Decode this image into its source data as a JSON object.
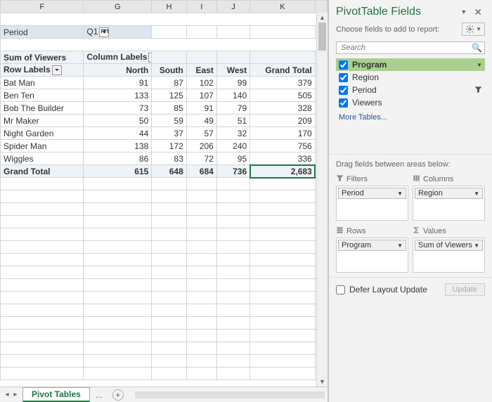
{
  "columns_visible": [
    "F",
    "G",
    "H",
    "I",
    "J",
    "K"
  ],
  "filter": {
    "label": "Period",
    "value": "Q1"
  },
  "pivot": {
    "values_label": "Sum of Viewers",
    "cols_label": "Column Labels",
    "rows_label": "Row Labels",
    "col_headers": [
      "North",
      "South",
      "East",
      "West",
      "Grand Total"
    ],
    "rows": [
      {
        "label": "Bat Man",
        "vals": [
          91,
          87,
          102,
          99,
          379
        ]
      },
      {
        "label": "Ben Ten",
        "vals": [
          133,
          125,
          107,
          140,
          505
        ]
      },
      {
        "label": "Bob The Builder",
        "vals": [
          73,
          85,
          91,
          79,
          328
        ]
      },
      {
        "label": "Mr Maker",
        "vals": [
          50,
          59,
          49,
          51,
          209
        ]
      },
      {
        "label": "Night Garden",
        "vals": [
          44,
          37,
          57,
          32,
          170
        ]
      },
      {
        "label": "Spider Man",
        "vals": [
          138,
          172,
          206,
          240,
          756
        ]
      },
      {
        "label": "Wiggles",
        "vals": [
          86,
          83,
          72,
          95,
          336
        ]
      }
    ],
    "grand_total_label": "Grand Total",
    "grand_total": [
      615,
      648,
      684,
      736,
      "2,683"
    ]
  },
  "tab_name": "Pivot Tables",
  "panel": {
    "title": "PivotTable Fields",
    "choose": "Choose fields to add to report:",
    "search_placeholder": "Search",
    "fields": [
      {
        "name": "Program",
        "checked": true,
        "active": true,
        "dropdown": true
      },
      {
        "name": "Region",
        "checked": true
      },
      {
        "name": "Period",
        "checked": true,
        "filter_icon": true
      },
      {
        "name": "Viewers",
        "checked": true
      }
    ],
    "more_tables": "More Tables...",
    "drag_label": "Drag fields between areas below:",
    "zones": {
      "filters": {
        "title": "Filters",
        "item": "Period"
      },
      "columns": {
        "title": "Columns",
        "item": "Region"
      },
      "rows": {
        "title": "Rows",
        "item": "Program"
      },
      "values": {
        "title": "Values",
        "item": "Sum of Viewers"
      }
    },
    "defer": "Defer Layout Update",
    "update": "Update"
  },
  "chart_data": {
    "type": "table",
    "title": "Sum of Viewers by Program and Region (Period = Q1)",
    "row_field": "Program",
    "column_field": "Region",
    "value_field": "Sum of Viewers",
    "columns": [
      "North",
      "South",
      "East",
      "West"
    ],
    "rows": [
      "Bat Man",
      "Ben Ten",
      "Bob The Builder",
      "Mr Maker",
      "Night Garden",
      "Spider Man",
      "Wiggles"
    ],
    "data": [
      [
        91,
        87,
        102,
        99
      ],
      [
        133,
        125,
        107,
        140
      ],
      [
        73,
        85,
        91,
        79
      ],
      [
        50,
        59,
        49,
        51
      ],
      [
        44,
        37,
        57,
        32
      ],
      [
        138,
        172,
        206,
        240
      ],
      [
        86,
        83,
        72,
        95
      ]
    ],
    "row_totals": [
      379,
      505,
      328,
      209,
      170,
      756,
      336
    ],
    "column_totals": [
      615,
      648,
      684,
      736
    ],
    "grand_total": 2683
  }
}
